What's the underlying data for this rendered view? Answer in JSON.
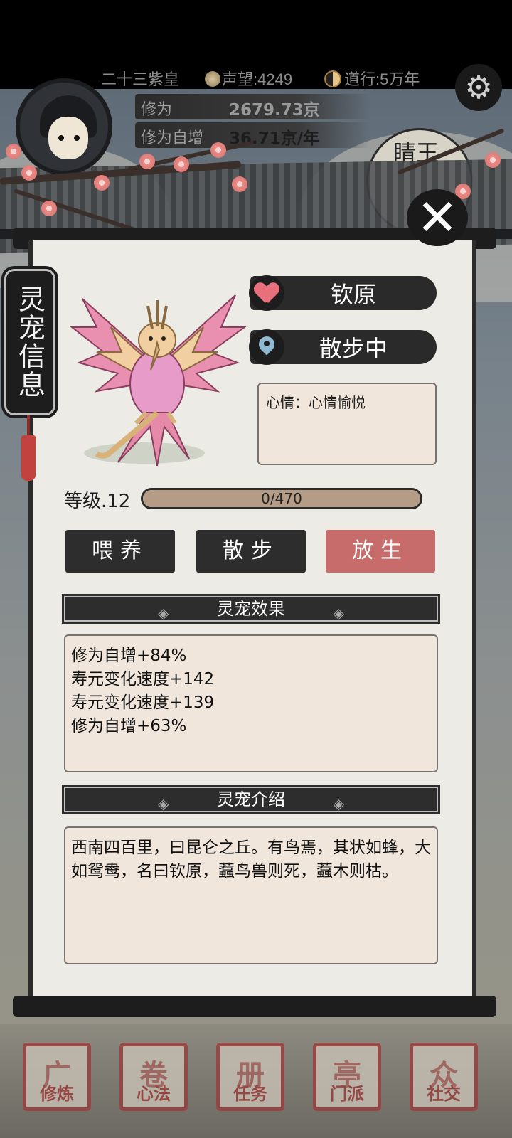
{
  "topbar": {
    "rank": "二十三紫皇",
    "reputation": "声望:4249",
    "daoxing": "道行:5万年"
  },
  "stats": {
    "cultivation_label": "修为",
    "cultivation_value": "2679.73京",
    "growth_label": "修为自增",
    "growth_value": "36.71京/年"
  },
  "background": {
    "sign_text": "睛王"
  },
  "side_tag": "灵宠信息",
  "pet": {
    "name": "钦原",
    "status": "散步中",
    "mood": "心情：心情愉悦",
    "level_label": "等级.12",
    "exp_text": "0/470",
    "exp_fraction": 0
  },
  "actions": {
    "feed": "喂养",
    "walk": "散步",
    "release": "放生"
  },
  "effects": {
    "title": "灵宠效果",
    "lines": [
      "修为自增+84%",
      "寿元变化速度+142",
      "寿元变化速度+139",
      "修为自增+63%"
    ]
  },
  "intro": {
    "title": "灵宠介绍",
    "text": "西南四百里，曰昆仑之丘。有鸟焉，其状如蜂，大如鸳鸯，名曰钦原，蠚鸟兽则死，蠚木则枯。"
  },
  "nav": [
    "修炼",
    "心法",
    "任务",
    "门派",
    "社交"
  ],
  "colors": {
    "accent_red": "#c86b6b",
    "panel_bg": "#edebe6",
    "ink": "#2d2d2e"
  }
}
